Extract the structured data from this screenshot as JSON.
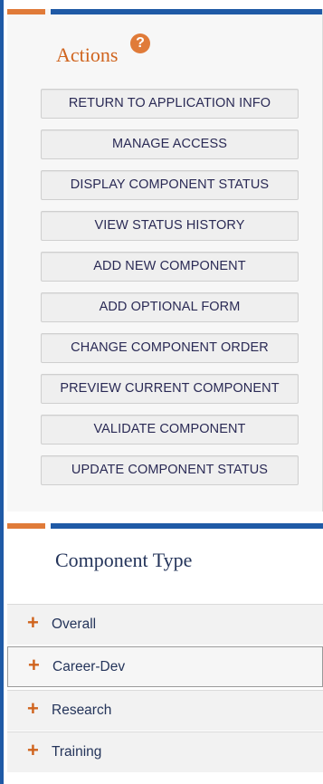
{
  "actions": {
    "title": "Actions",
    "help_symbol": "?",
    "buttons": [
      {
        "label": "RETURN TO APPLICATION INFO"
      },
      {
        "label": "MANAGE ACCESS"
      },
      {
        "label": "DISPLAY COMPONENT STATUS"
      },
      {
        "label": "VIEW STATUS HISTORY"
      },
      {
        "label": "ADD NEW COMPONENT"
      },
      {
        "label": "ADD OPTIONAL FORM"
      },
      {
        "label": "CHANGE COMPONENT ORDER"
      },
      {
        "label": "PREVIEW CURRENT COMPONENT"
      },
      {
        "label": "VALIDATE COMPONENT"
      },
      {
        "label": "UPDATE COMPONENT STATUS"
      }
    ]
  },
  "component_type": {
    "title": "Component Type",
    "expand_symbol": "+",
    "items": [
      {
        "label": "Overall"
      },
      {
        "label": "Career-Dev",
        "selected": true
      },
      {
        "label": "Research"
      },
      {
        "label": "Training"
      }
    ]
  },
  "colors": {
    "accent_orange": "#e07b39",
    "accent_blue": "#1f5aa6",
    "label_navy": "#24345a",
    "title_orange": "#d0641e"
  },
  "icons": {
    "help": "help-circle-icon",
    "expand": "plus-icon"
  }
}
